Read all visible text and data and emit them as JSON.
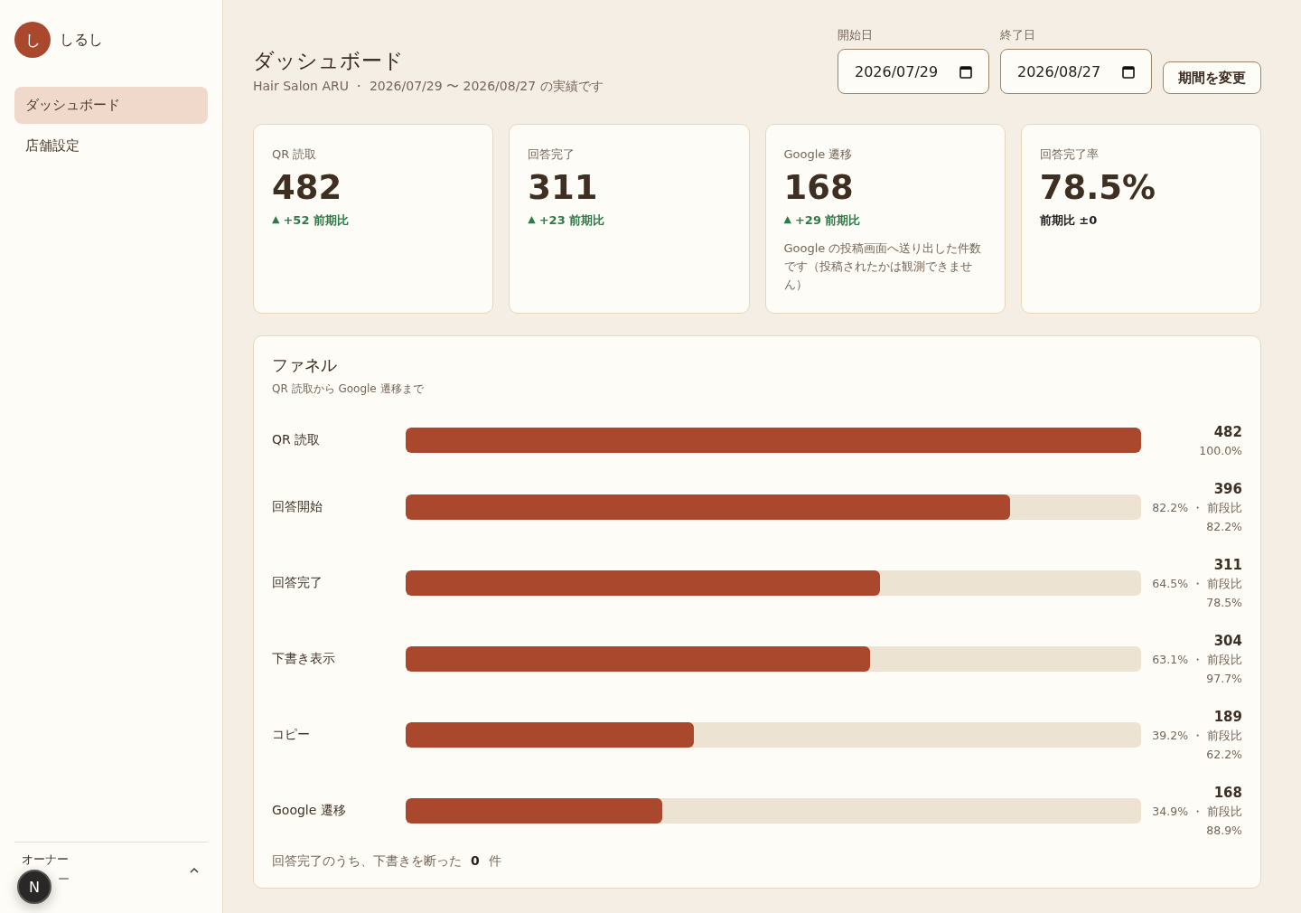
{
  "sidebar": {
    "logo_letter": "し",
    "brand": "しるし",
    "items": [
      {
        "label": "ダッシュボード",
        "selected": true
      },
      {
        "label": "店舗設定",
        "selected": false
      }
    ],
    "user": {
      "role": "オーナー",
      "name_visible": "ー",
      "badge": "N"
    }
  },
  "header": {
    "title": "ダッシュボード",
    "subtitle": "Hair Salon ARU ・ 2026/07/29 〜 2026/08/27 の実績です",
    "start": {
      "label": "開始日",
      "value": "2026/07/29"
    },
    "end": {
      "label": "終了日",
      "value": "2026/08/27"
    },
    "apply_button": "期間を変更"
  },
  "stats": [
    {
      "label": "QR 読取",
      "value": "482",
      "arrow": "▲",
      "delta": "+52 前期比"
    },
    {
      "label": "回答完了",
      "value": "311",
      "arrow": "▲",
      "delta": "+23 前期比"
    },
    {
      "label": "Google 遷移",
      "value": "168",
      "arrow": "▲",
      "delta": "+29 前期比",
      "note": "Google の投稿画面へ送り出した件数です（投稿されたかは観測できません）"
    },
    {
      "label": "回答完了率",
      "value": "78.5%",
      "delta": "前期比 ±0"
    }
  ],
  "funnel": {
    "title": "ファネル",
    "subtitle": "QR 読取から Google 遷移まで",
    "steps": [
      {
        "label": "QR 読取",
        "level": 1.0,
        "count": "482",
        "detail": "100.0%"
      },
      {
        "label": "回答開始",
        "level": 0.822,
        "count": "396",
        "detail": "82.2% ・ 前段比",
        "step": "82.2%"
      },
      {
        "label": "回答完了",
        "level": 0.645,
        "count": "311",
        "detail": "64.5% ・ 前段比",
        "step": "78.5%"
      },
      {
        "label": "下書き表示",
        "level": 0.631,
        "count": "304",
        "detail": "63.1% ・ 前段比",
        "step": "97.7%"
      },
      {
        "label": "コピー",
        "level": 0.392,
        "count": "189",
        "detail": "39.2% ・ 前段比",
        "step": "62.2%"
      },
      {
        "label": "Google 遷移",
        "level": 0.349,
        "count": "168",
        "detail": "34.9% ・ 前段比",
        "step": "88.9%"
      }
    ],
    "footnote_before": "回答完了のうち、下書きを断った",
    "footnote_count": "0",
    "footnote_after": "件"
  }
}
